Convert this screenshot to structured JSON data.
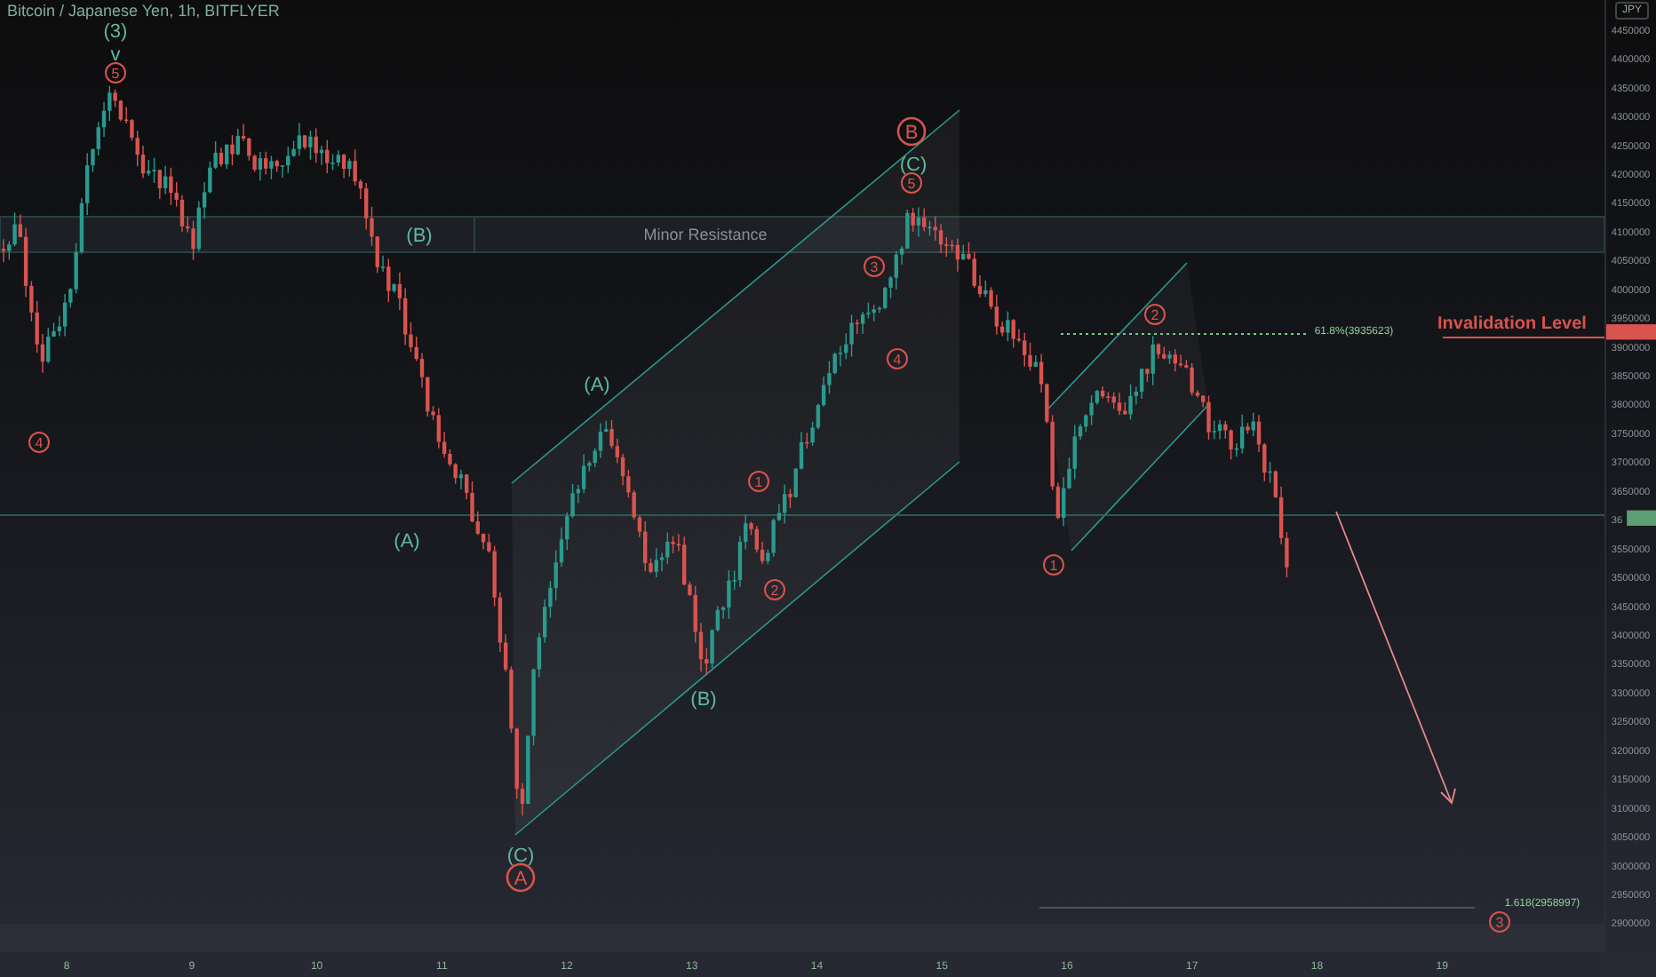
{
  "title": "Bitcoin / Japanese Yen, 1h, BITFLYER",
  "currency": "JPY",
  "price_axis": {
    "ticks": [
      "4450000",
      "4400000",
      "4350000",
      "4300000",
      "4250000",
      "4200000",
      "4150000",
      "4100000",
      "4050000",
      "4000000",
      "3950000",
      "3900000",
      "3850000",
      "3800000",
      "3750000",
      "3700000",
      "3650000",
      "36",
      "3550000",
      "3500000",
      "3450000",
      "3400000",
      "3350000",
      "3300000",
      "3250000",
      "3200000",
      "3150000",
      "3100000",
      "3050000",
      "3000000",
      "2950000",
      "2900000"
    ]
  },
  "time_axis": {
    "ticks": [
      "8",
      "9",
      "10",
      "11",
      "12",
      "13",
      "14",
      "15",
      "16",
      "17",
      "18",
      "19"
    ]
  },
  "annotations": [
    {
      "kind": "wave",
      "text": "(3)"
    },
    {
      "kind": "wave",
      "text": "v"
    },
    {
      "kind": "circled",
      "text": "5"
    },
    {
      "kind": "circled",
      "text": "4"
    },
    {
      "kind": "wave",
      "text": "(B)"
    },
    {
      "kind": "note",
      "text": "Minor Resistance"
    },
    {
      "kind": "wave",
      "text": "(A)"
    },
    {
      "kind": "wave",
      "text": "(C)"
    },
    {
      "kind": "major",
      "text": "A"
    },
    {
      "kind": "wave",
      "text": "(A)"
    },
    {
      "kind": "wave",
      "text": "(B)"
    },
    {
      "kind": "circled",
      "text": "1"
    },
    {
      "kind": "circled",
      "text": "2"
    },
    {
      "kind": "circled",
      "text": "3"
    },
    {
      "kind": "circled",
      "text": "4"
    },
    {
      "kind": "major",
      "text": "B"
    },
    {
      "kind": "wave",
      "text": "(C)"
    },
    {
      "kind": "circled",
      "text": "5"
    },
    {
      "kind": "circled",
      "text": "2"
    },
    {
      "kind": "circled",
      "text": "1"
    },
    {
      "kind": "level",
      "text": "61.8%(3935623)"
    },
    {
      "kind": "invalidation",
      "text": "Invalidation Level"
    },
    {
      "kind": "level",
      "text": "1.618(2958997)"
    },
    {
      "kind": "circled",
      "text": "3"
    }
  ]
}
